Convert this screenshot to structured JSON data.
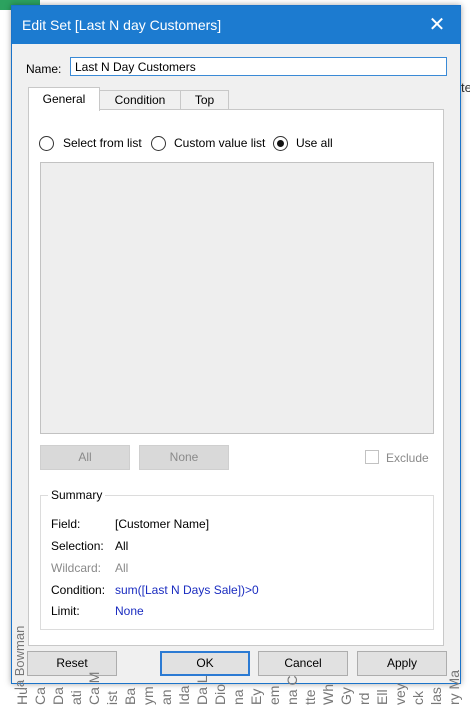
{
  "background": {
    "right_fragment": "te",
    "bottom_labels": [
      "Ca",
      "Da",
      "ati",
      "Ca M",
      "ist",
      "Ba",
      "ym",
      "an",
      "Ida",
      "Da L",
      "Dio",
      "na",
      "Ey",
      "em",
      "na C",
      "tte",
      "Wh",
      "Gy",
      "rd",
      "Ell",
      "vey",
      "ck",
      "las",
      "ry Ma",
      "Hu"
    ],
    "left_label": "la Bowman"
  },
  "dialog": {
    "title": "Edit Set [Last N day Customers]",
    "close_icon": "close-icon",
    "name_label": "Name:",
    "name_value": "Last N Day Customers",
    "tabs": [
      {
        "label": "General",
        "active": true
      },
      {
        "label": "Condition",
        "active": false
      },
      {
        "label": "Top",
        "active": false
      }
    ],
    "radios": [
      {
        "label": "Select from list",
        "checked": false
      },
      {
        "label": "Custom value list",
        "checked": false
      },
      {
        "label": "Use all",
        "checked": true
      }
    ],
    "all_button": "All",
    "none_button": "None",
    "exclude_label": "Exclude",
    "summary": {
      "legend": "Summary",
      "rows": [
        {
          "key": "Field:",
          "value": "[Customer Name]"
        },
        {
          "key": "Selection:",
          "value": "All"
        },
        {
          "key": "Wildcard:",
          "value": "All"
        },
        {
          "key": "Condition:",
          "value": "sum([Last N Days Sale])>0"
        },
        {
          "key": "Limit:",
          "value": "None"
        }
      ]
    },
    "footer": {
      "reset": "Reset",
      "ok": "OK",
      "cancel": "Cancel",
      "apply": "Apply"
    },
    "colors": {
      "titlebar": "#1c7bd0",
      "link_blue": "#1a2cc0"
    }
  }
}
